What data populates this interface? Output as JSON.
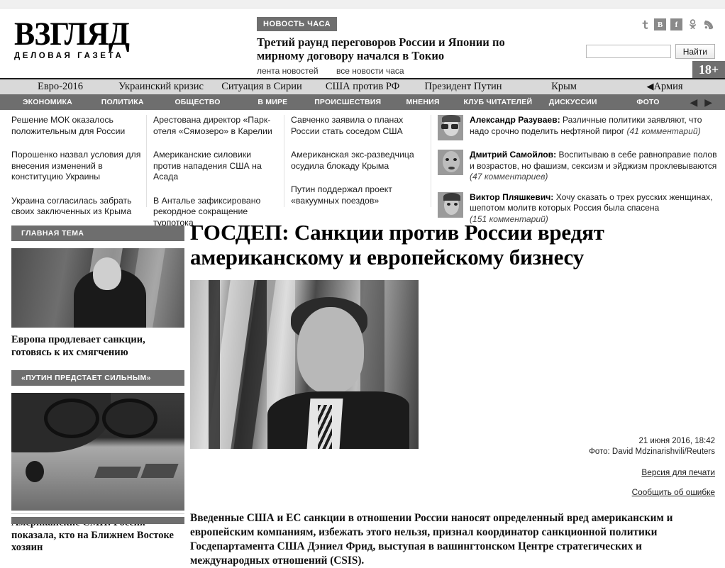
{
  "site": {
    "logo_main": "ВЗГЛЯД",
    "logo_sub": "ДЕЛОВАЯ ГАЗЕТА",
    "age_badge": "18+"
  },
  "hour_news": {
    "badge": "НОВОСТЬ ЧАСА",
    "title": "Третий раунд переговоров России и Японии по мирному договору начался в Токио",
    "link_feed": "лента новостей",
    "link_all": "все новости часа"
  },
  "social": {
    "twitter": "t",
    "vk": "B",
    "facebook": "f",
    "odnoklassniki": "ok",
    "rss": "rss"
  },
  "search": {
    "value": "",
    "placeholder": "",
    "button": "Найти"
  },
  "nav_top": [
    "Евро-2016",
    "Украинский кризис",
    "Ситуация в Сирии",
    "США против РФ",
    "Президент Путин",
    "Крым",
    "Армия"
  ],
  "nav_main": [
    "ЭКОНОМИКА",
    "ПОЛИТИКА",
    "ОБЩЕСТВО",
    "В МИРЕ",
    "ПРОИСШЕСТВИЯ",
    "МНЕНИЯ",
    "КЛУБ ЧИТАТЕЛЕЙ",
    "ДИСКУССИИ",
    "ФОТО"
  ],
  "headlines": {
    "col1": [
      "Решение МОК оказалось положительным для России",
      "Порошенко назвал условия для внесения изменений в конституцию Украины",
      "Украина согласилась забрать своих заключенных из Крыма"
    ],
    "col2": [
      "Арестована директор «Парк-отеля «Сямозеро» в Карелии",
      "Американские силовики против нападения США на Асада",
      "В Анталье зафиксировано рекордное сокращение турпотока"
    ],
    "col3": [
      "Савченко заявила о планах России стать соседом США",
      "Американская экс-разведчица осудила блокаду Крыма",
      "Путин поддержал проект «вакуумных поездов»"
    ]
  },
  "opinions": [
    {
      "author": "Александр Разуваев:",
      "text": " Различные политики заявляют, что надо срочно поделить нефтяной пирог",
      "comments": "(41 комментарий)"
    },
    {
      "author": "Дмитрий Самойлов:",
      "text": " Воспитываю в себе равноправие полов и возрастов, но фашизм, сексизм и эйджизм проклевываются",
      "comments": "(47 комментариев)"
    },
    {
      "author": "Виктор Пляшкевич:",
      "text": " Хочу сказать о трех русских женщинах, шепотом молитв которых Россия была спасена",
      "comments": "(151 комментарий)"
    }
  ],
  "sidebar": {
    "section1": {
      "header": "ГЛАВНАЯ ТЕМА",
      "title": "Европа продлевает санкции, готовясь к их смягчению"
    },
    "section2": {
      "header": "«ПУТИН ПРЕДСТАЕТ СИЛЬНЫМ»",
      "title": "Американские СМИ: Россия показала, кто на Ближнем Востоке хозяин"
    },
    "section3": {
      "header": ""
    }
  },
  "article": {
    "title": "ГОСДЕП: Санкции против России вредят американскому и европейскому бизнесу",
    "date": "21 июня 2016, 18:42",
    "photo_credit": "Фото: David Mdzinarishvili/Reuters",
    "print_link": "Версия для печати",
    "error_link": "Сообщить об ошибке",
    "lead": "Введенные США и ЕС санкции в отношении России наносят определенный вред американским и европейским компаниям, избежать этого нельзя, признал координатор санкционной политики Госдепартамента США Дэниел Фрид, выступая в вашингтонском Центре стратегических и международных отношений (CSIS)."
  },
  "colors": {
    "nav_gray": "#6e6e6e",
    "nav_light": "#d9d9d9",
    "text": "#1a1a1a"
  }
}
